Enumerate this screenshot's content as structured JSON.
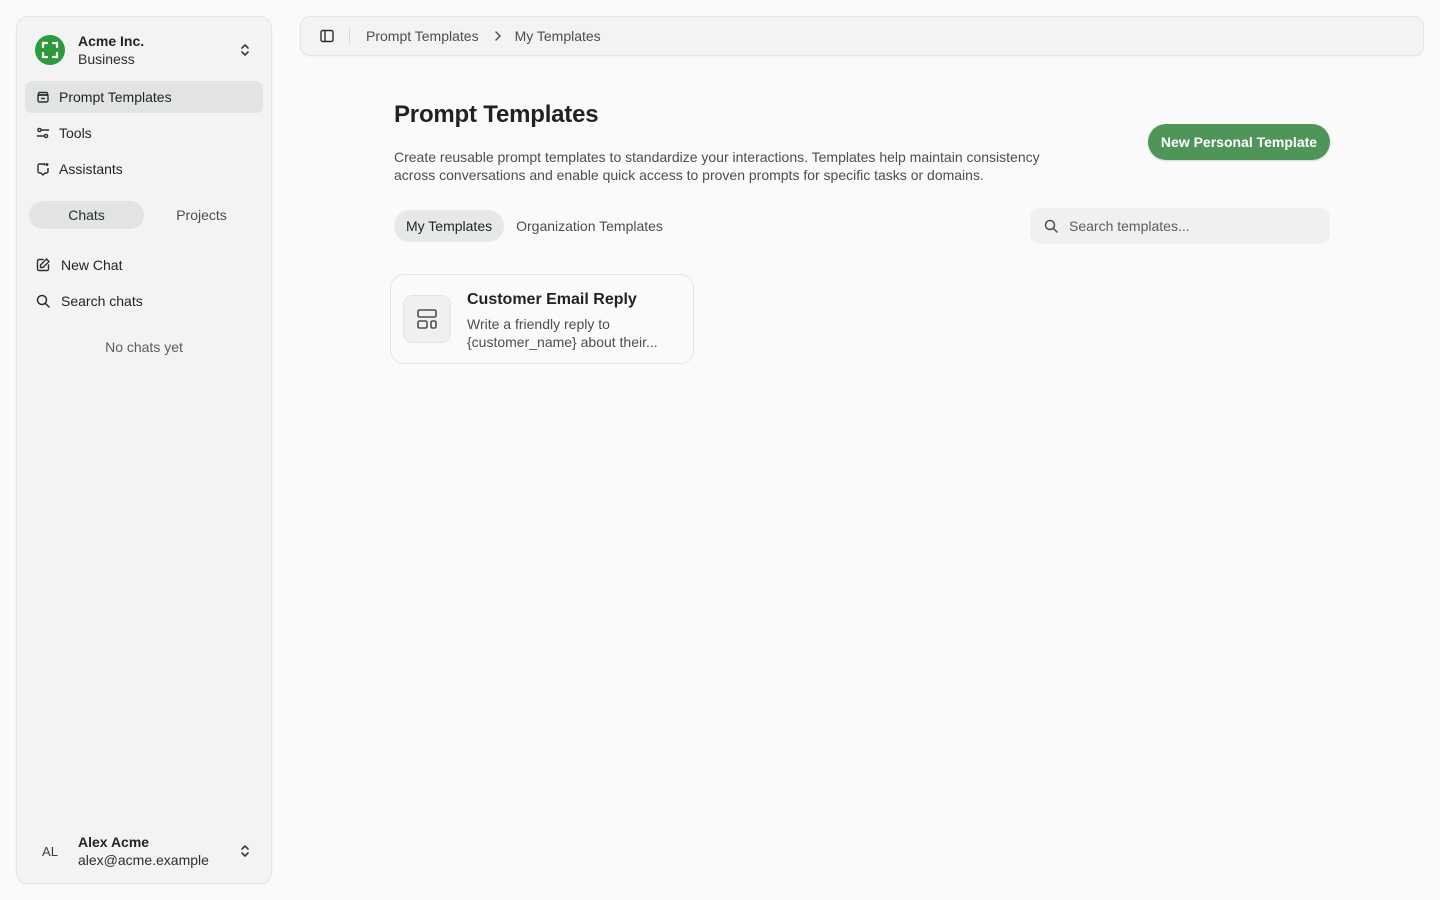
{
  "sidebar": {
    "org": {
      "name": "Acme Inc.",
      "plan": "Business",
      "logo_color": "#2d9a3b"
    },
    "nav": [
      {
        "label": "Prompt Templates",
        "icon": "template-icon",
        "active": true
      },
      {
        "label": "Tools",
        "icon": "sliders-icon",
        "active": false
      },
      {
        "label": "Assistants",
        "icon": "assistant-icon",
        "active": false
      }
    ],
    "segments": {
      "chats": "Chats",
      "projects": "Projects"
    },
    "actions": {
      "new_chat": "New Chat",
      "search_chats": "Search chats"
    },
    "empty_text": "No chats yet",
    "user": {
      "initials": "AL",
      "name": "Alex Acme",
      "email": "alex@acme.example"
    }
  },
  "topbar": {
    "breadcrumb": [
      "Prompt Templates",
      "My Templates"
    ]
  },
  "main": {
    "title": "Prompt Templates",
    "description": "Create reusable prompt templates to standardize your interactions. Templates help maintain consistency across conversations and enable quick access to proven prompts for specific tasks or domains.",
    "new_button": "New Personal Template",
    "tabs": [
      "My Templates",
      "Organization Templates"
    ],
    "search_placeholder": "Search templates...",
    "templates": [
      {
        "title": "Customer Email Reply",
        "description": "Write a friendly reply to {customer_name} about their..."
      }
    ]
  },
  "colors": {
    "accent": "#4f9458",
    "background": "#f9faf9",
    "sidebar": "#f2f3f2"
  }
}
